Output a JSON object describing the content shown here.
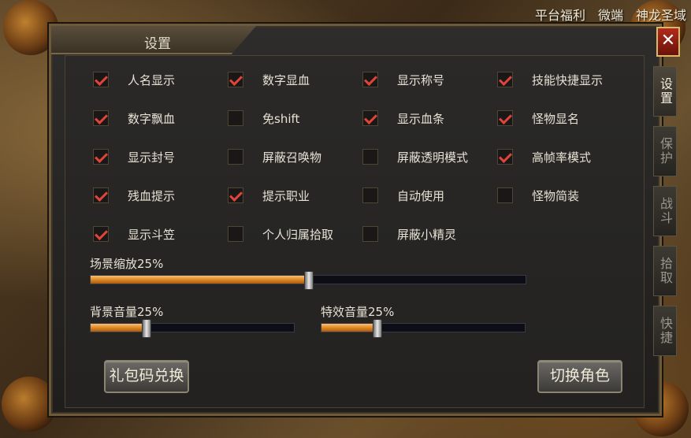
{
  "topbar": {
    "links": [
      "平台福利",
      "微端",
      "神龙圣域"
    ]
  },
  "panel": {
    "title": "设置",
    "close_label": "✕"
  },
  "options": [
    {
      "label": "人名显示",
      "checked": true
    },
    {
      "label": "数字显血",
      "checked": true
    },
    {
      "label": "显示称号",
      "checked": true
    },
    {
      "label": "技能快捷显示",
      "checked": true
    },
    {
      "label": "数字飘血",
      "checked": true
    },
    {
      "label": "免shift",
      "checked": false
    },
    {
      "label": "显示血条",
      "checked": true
    },
    {
      "label": "怪物显名",
      "checked": true
    },
    {
      "label": "显示封号",
      "checked": true
    },
    {
      "label": "屏蔽召唤物",
      "checked": false
    },
    {
      "label": "屏蔽透明模式",
      "checked": false
    },
    {
      "label": "高帧率模式",
      "checked": true
    },
    {
      "label": "残血提示",
      "checked": true
    },
    {
      "label": "提示职业",
      "checked": true
    },
    {
      "label": "自动使用",
      "checked": false
    },
    {
      "label": "怪物简装",
      "checked": false
    },
    {
      "label": "显示斗笠",
      "checked": true
    },
    {
      "label": "个人归属拾取",
      "checked": false
    },
    {
      "label": "屏蔽小精灵",
      "checked": false
    }
  ],
  "sliders": {
    "scene_zoom": {
      "label": "场景缩放25%",
      "value": 0.5
    },
    "bg_volume": {
      "label": "背景音量25%",
      "value": 0.27
    },
    "fx_volume": {
      "label": "特效音量25%",
      "value": 0.27
    }
  },
  "buttons": {
    "gift_code": "礼包码兑换",
    "switch_role": "切换角色"
  },
  "side_tabs": [
    {
      "label": "设置",
      "active": true
    },
    {
      "label": "保护",
      "active": false
    },
    {
      "label": "战斗",
      "active": false
    },
    {
      "label": "拾取",
      "active": false
    },
    {
      "label": "快捷",
      "active": false
    }
  ],
  "colors": {
    "accent": "#e0443a",
    "slider_fill": "#e08a22"
  }
}
